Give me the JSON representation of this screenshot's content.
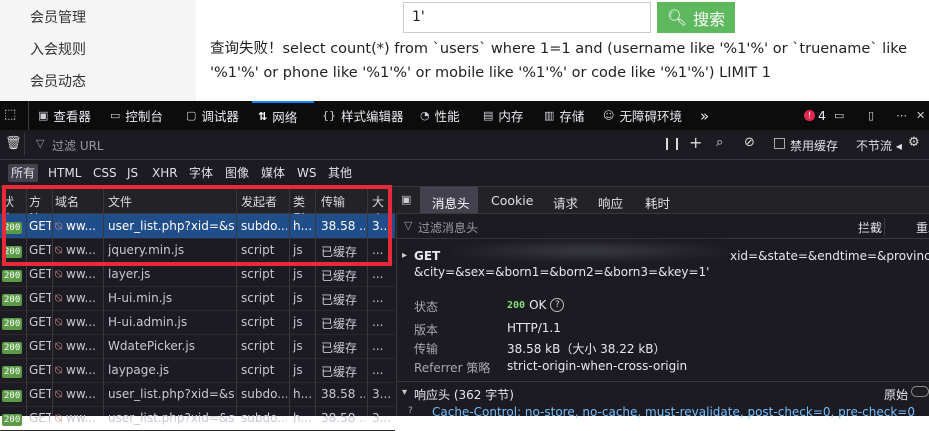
{
  "web": {
    "nav_items": [
      "会员管理",
      "入会规则",
      "会员动态"
    ],
    "search_value": "1'",
    "search_button": "搜索",
    "error_message": "查询失败！select count(*) from `users` where 1=1 and (username like '%1'%' or `truename` like '%1'%' or phone like '%1'%' or mobile like '%1'%' or code like '%1'%') LIMIT 1"
  },
  "devtools": {
    "tabs": [
      "查看器",
      "控制台",
      "调试器",
      "网络",
      "样式编辑器",
      "性能",
      "内存",
      "存储",
      "无障碍环境"
    ],
    "active_tab": "网络",
    "error_count": "4",
    "filter_placeholder": "过滤 URL",
    "disable_cache_label": "禁用缓存",
    "throttle_label": "不节流",
    "filter_types": [
      "所有",
      "HTML",
      "CSS",
      "JS",
      "XHR",
      "字体",
      "图像",
      "媒体",
      "WS",
      "其他"
    ],
    "columns": [
      "状态",
      "方法",
      "域名",
      "文件",
      "发起者",
      "类型",
      "传输",
      "大小"
    ],
    "rows": [
      {
        "status": "200",
        "method": "GET",
        "domain": "ww...",
        "file": "user_list.php?xid=&state",
        "initiator": "subdo...",
        "type": "h...",
        "transfer": "38.58 ...",
        "size": "3..."
      },
      {
        "status": "200",
        "method": "GET",
        "domain": "ww...",
        "file": "jquery.min.js",
        "initiator": "script",
        "type": "js",
        "transfer": "已缓存",
        "size": "..."
      },
      {
        "status": "200",
        "method": "GET",
        "domain": "ww...",
        "file": "layer.js",
        "initiator": "script",
        "type": "js",
        "transfer": "已缓存",
        "size": "..."
      },
      {
        "status": "200",
        "method": "GET",
        "domain": "ww...",
        "file": "H-ui.min.js",
        "initiator": "script",
        "type": "js",
        "transfer": "已缓存",
        "size": "..."
      },
      {
        "status": "200",
        "method": "GET",
        "domain": "ww...",
        "file": "H-ui.admin.js",
        "initiator": "script",
        "type": "js",
        "transfer": "已缓存",
        "size": "..."
      },
      {
        "status": "200",
        "method": "GET",
        "domain": "ww...",
        "file": "WdatePicker.js",
        "initiator": "script",
        "type": "js",
        "transfer": "已缓存",
        "size": "..."
      },
      {
        "status": "200",
        "method": "GET",
        "domain": "ww...",
        "file": "laypage.js",
        "initiator": "script",
        "type": "js",
        "transfer": "已缓存",
        "size": "..."
      },
      {
        "status": "200",
        "method": "GET",
        "domain": "ww...",
        "file": "user_list.php?xid=&state",
        "initiator": "subdo...",
        "type": "h...",
        "transfer": "38.58 ...",
        "size": "3..."
      },
      {
        "status": "200",
        "method": "GET",
        "domain": "ww...",
        "file": "user_list.php?xid=&state",
        "initiator": "subdo...",
        "type": "h...",
        "transfer": "38.58 ...",
        "size": "3..."
      }
    ],
    "detail_tabs": [
      "消息头",
      "Cookie",
      "请求",
      "响应",
      "耗时"
    ],
    "detail_filter_placeholder": "过滤消息头",
    "block_label": "拦截",
    "resend_label": "重发",
    "request_method": "GET",
    "request_url_line1": "xid=&state=&endtime=&province=",
    "request_url_line2": "&city=&sex=&born1=&born2=&born3=&key=1'",
    "status_label": "状态",
    "status_code": "200",
    "status_text": "OK",
    "version_label": "版本",
    "version_value": "HTTP/1.1",
    "transfer_label": "传输",
    "transfer_value": "38.58 kB（大小 38.22 kB）",
    "referrer_label": "Referrer 策略",
    "referrer_value": "strict-origin-when-cross-origin",
    "response_headers_label": "响应头 (362 字节)",
    "raw_label": "原始",
    "cache_control_line": "Cache-Control: no-store, no-cache, must-revalidate, post-check=0, pre-check=0"
  }
}
